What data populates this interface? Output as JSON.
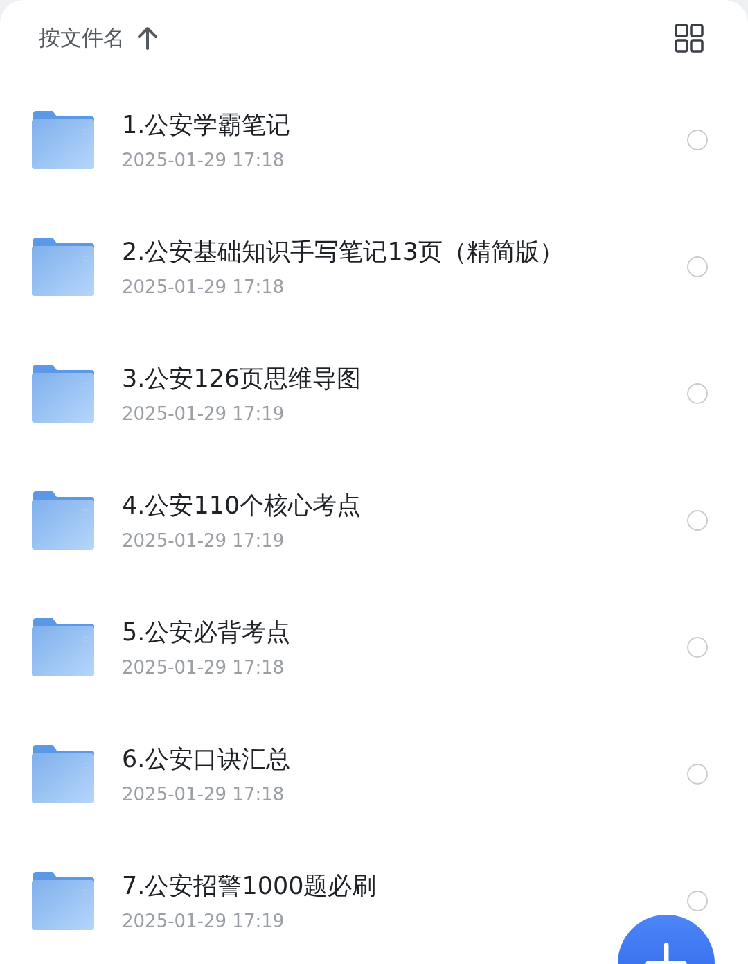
{
  "sort_bar": {
    "label": "按文件名",
    "ascending": true
  },
  "files": [
    {
      "name": "1.公安学霸笔记",
      "date": "2025-01-29 17:18",
      "selected": false
    },
    {
      "name": "2.公安基础知识手写笔记13页（精简版）",
      "date": "2025-01-29 17:18",
      "selected": false
    },
    {
      "name": "3.公安126页思维导图",
      "date": "2025-01-29 17:19",
      "selected": false
    },
    {
      "name": "4.公安110个核心考点",
      "date": "2025-01-29 17:19",
      "selected": false
    },
    {
      "name": "5.公安必背考点",
      "date": "2025-01-29 17:18",
      "selected": false
    },
    {
      "name": "6.公安口诀汇总",
      "date": "2025-01-29 17:18",
      "selected": false
    },
    {
      "name": "7.公安招警1000题必刷",
      "date": "2025-01-29 17:19",
      "selected": false
    }
  ]
}
